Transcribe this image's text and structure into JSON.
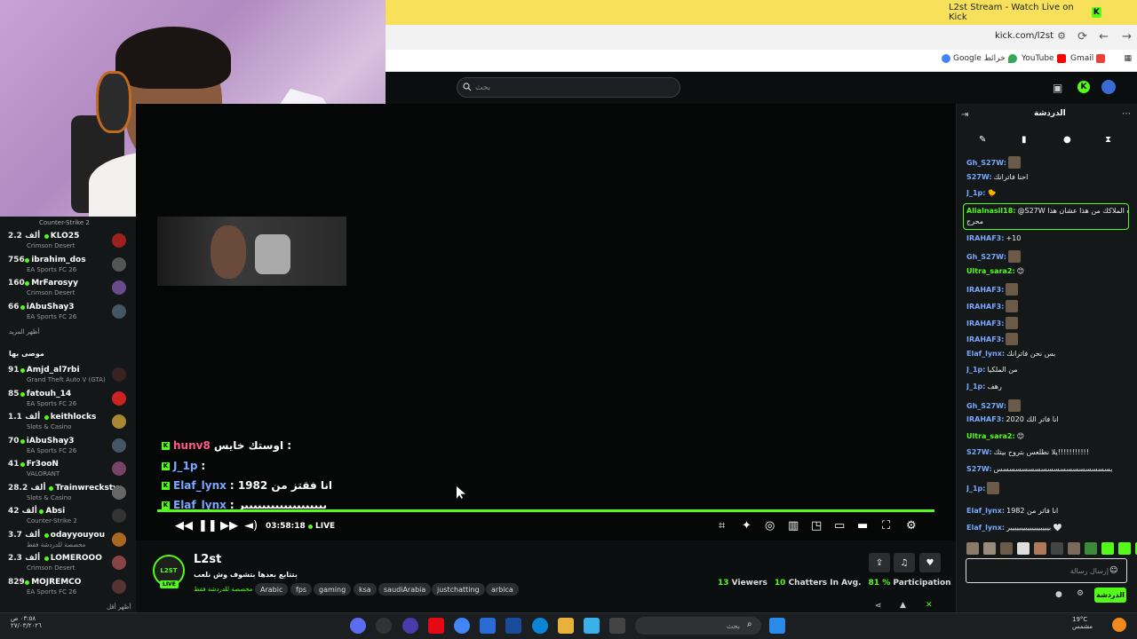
{
  "browser": {
    "tab_title": "L2st Stream - Watch Live on Kick",
    "tab_badge": "K",
    "new_tab": "+",
    "close": "✕",
    "url": "kick.com/l2st",
    "bookmarks": [
      "Google خرائط",
      "YouTube",
      "Gmail"
    ]
  },
  "sidebar": {
    "top_game": "Counter-Strike 2",
    "channels": [
      {
        "count": "2.2 ألف",
        "name": "KLO25",
        "game": "Crimson Desert",
        "color": "#a02020"
      },
      {
        "count": "756",
        "name": "ibrahim_dos",
        "game": "EA Sports FC 26",
        "color": "#555"
      },
      {
        "count": "160",
        "name": "MrFarosyy",
        "game": "Crimson Desert",
        "color": "#6a4a8a"
      },
      {
        "count": "66",
        "name": "iAbuShay3",
        "game": "EA Sports FC 26",
        "color": "#445566"
      }
    ],
    "show_more_1": "أظهر المزيد",
    "recommended_label": "موصى بها",
    "recommended": [
      {
        "count": "91",
        "name": "Amjd_al7rbi",
        "game": "Grand Theft Auto V (GTA)",
        "color": "#3a2222"
      },
      {
        "count": "85",
        "name": "fatouh_14",
        "game": "EA Sports FC 26",
        "color": "#cc2222"
      },
      {
        "count": "1.1 ألف",
        "name": "keithlocks",
        "game": "Slots & Casino",
        "color": "#aa8833"
      },
      {
        "count": "70",
        "name": "iAbuShay3",
        "game": "EA Sports FC 26",
        "color": "#445566"
      },
      {
        "count": "41",
        "name": "Fr3ooN",
        "game": "VALORANT",
        "color": "#774466"
      },
      {
        "count": "28.2 ألف",
        "name": "Trainwreckstv",
        "game": "Slots & Casino",
        "color": "#666"
      },
      {
        "count": "42 ألف",
        "name": "Absi",
        "game": "Counter-Strike 2",
        "color": "#333"
      },
      {
        "count": "3.7 ألف",
        "name": "odayyouyou",
        "game": "مخصصة للدردشة فقط",
        "color": "#aa6622"
      },
      {
        "count": "2.3 ألف",
        "name": "LOMEROOO",
        "game": "Crimson Desert",
        "color": "#884444"
      },
      {
        "count": "829",
        "name": "MOJREMCO",
        "game": "EA Sports FC 26",
        "color": "#553333"
      }
    ],
    "show_more_2": "أظهر أقل"
  },
  "search": {
    "placeholder": "بحث"
  },
  "overlay_chat": [
    {
      "user": "hunv8",
      "text": "اوستك خايس :",
      "color": "#ff5a8a"
    },
    {
      "user": "J_1p",
      "text": ":",
      "color": "#7aa8ff"
    },
    {
      "user": "Elaf_lynx",
      "text": ": 1982 انا فقتز من",
      "color": "#7aa8ff"
    },
    {
      "user": "Elaf_lynx",
      "text": ": بيييييييييييييييييير",
      "color": "#7aa8ff"
    }
  ],
  "player": {
    "time": "03:58:18",
    "live": "LIVE"
  },
  "channel": {
    "logo_text": "L2ST",
    "live_badge": "LIVE",
    "name": "L2st",
    "title": "بتتابع بعدها بتشوف وش نلعب",
    "category": "مخصصة للدردشة فقط",
    "tags": [
      "Arabic",
      "fps",
      "gaming",
      "ksa",
      "saudiArabia",
      "justchatting",
      "arbica"
    ],
    "viewers": "13",
    "viewers_label": "Viewers",
    "chatters": "10",
    "chatters_label": "Chatters In Avg.",
    "participation": "81 %",
    "participation_label": "Participation"
  },
  "chat": {
    "title": "الدردشة",
    "messages": [
      {
        "user": "Gh_S27W:",
        "text": "",
        "color": "#7aa8ff",
        "emote": true
      },
      {
        "user": "S27W:",
        "text": "احنا فاترانك",
        "color": "#7aa8ff",
        "emote": false
      },
      {
        "user": "J_1p:",
        "text": "🐤",
        "color": "#7aa8ff",
        "emote": false
      },
      {
        "user": "Alialnasil18:",
        "text": "@S27W عوده الملاكك من هذا عشان هذا",
        "color": "#53fc18",
        "emote": false
      },
      {
        "user": "",
        "text": "محرج",
        "color": "#fff",
        "emote": false
      },
      {
        "user": "IRAHAF3:",
        "text": "+10",
        "color": "#7aa8ff",
        "emote": false
      },
      {
        "user": "Gh_S27W:",
        "text": "",
        "color": "#7aa8ff",
        "emote": true
      },
      {
        "user": "Ultra_sara2:",
        "text": "😊",
        "color": "#53fc18",
        "emote": false
      },
      {
        "user": "IRAHAF3:",
        "text": "",
        "color": "#7aa8ff",
        "emote": true
      },
      {
        "user": "IRAHAF3:",
        "text": "",
        "color": "#7aa8ff",
        "emote": true
      },
      {
        "user": "IRAHAF3:",
        "text": "",
        "color": "#7aa8ff",
        "emote": true
      },
      {
        "user": "IRAHAF3:",
        "text": "",
        "color": "#7aa8ff",
        "emote": true
      },
      {
        "user": "Elaf_lynx:",
        "text": "بس نحن فاترانك",
        "color": "#7aa8ff",
        "emote": false
      },
      {
        "user": "J_1p:",
        "text": "من الملكيا",
        "color": "#7aa8ff",
        "emote": false
      },
      {
        "user": "J_1p:",
        "text": "رهف",
        "color": "#7aa8ff",
        "emote": false
      },
      {
        "user": "Gh_S27W:",
        "text": "",
        "color": "#7aa8ff",
        "emote": true
      },
      {
        "user": "IRAHAF3:",
        "text": "2020 انا فاتر الك",
        "color": "#7aa8ff",
        "emote": false
      },
      {
        "user": "Ultra_sara2:",
        "text": "😊",
        "color": "#53fc18",
        "emote": false
      },
      {
        "user": "S27W:",
        "text": "يلا نطلعس بتروح بيتك!!!!!!!!!!!",
        "color": "#7aa8ff",
        "emote": false
      },
      {
        "user": "S27W:",
        "text": "بسسسسسسسسسسسسسسسسسس",
        "color": "#7aa8ff",
        "emote": false
      },
      {
        "user": "J_1p:",
        "text": "",
        "color": "#7aa8ff",
        "emote": true
      },
      {
        "user": "Elaf_lynx:",
        "text": "1982 انا فاتر من",
        "color": "#7aa8ff",
        "emote": false
      },
      {
        "user": "Elaf_lynx:",
        "text": "بيييييييييييييييييير 🤍",
        "color": "#7aa8ff",
        "emote": false
      }
    ],
    "input_placeholder": "إرسال رسالة",
    "send_label": "الدردشة"
  },
  "taskbar": {
    "time": "٠٣:٥٨ ص",
    "date": "٢٧/٠٣/٢٠٢٦",
    "search_placeholder": "بحث",
    "weather_temp": "19°C",
    "weather_desc": "مشمس"
  }
}
